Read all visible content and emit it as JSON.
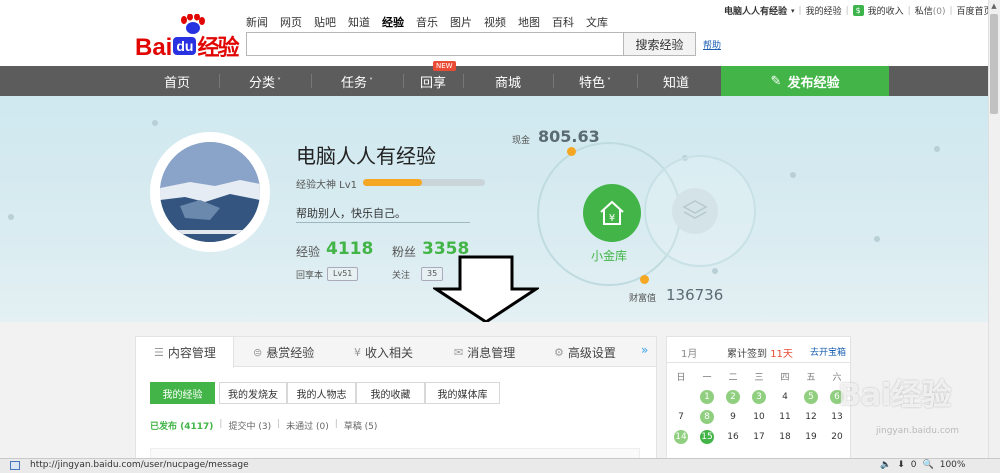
{
  "header": {
    "logo_bai": "Bai",
    "logo_du": "du",
    "logo_jingyan": "经验",
    "topnav": [
      "新闻",
      "网页",
      "贴吧",
      "知道",
      "经验",
      "音乐",
      "图片",
      "视频",
      "地图",
      "百科",
      "文库"
    ],
    "topnav_active": "经验",
    "search_value": "",
    "search_button": "搜索经验",
    "help": "帮助",
    "user": {
      "name": "电脑人人有经验",
      "my_exp": "我的经验",
      "my_income": "我的收入",
      "messages": "私信",
      "message_count": "(0)",
      "home": "百度首页"
    }
  },
  "mainnav": {
    "items": [
      "首页",
      "分类",
      "任务",
      "回享",
      "商城",
      "特色",
      "知道"
    ],
    "new_badge": "NEW",
    "publish": "发布经验"
  },
  "profile": {
    "name": "电脑人人有经验",
    "level": "经验大神 Lv1",
    "level_progress": 0.48,
    "motto": "帮助别人，快乐自己。",
    "exp_label": "经验",
    "exp_value": "4118",
    "fans_label": "粉丝",
    "fans_value": "3358",
    "huixiang_label": "回享本",
    "huixiang_value": "Lv51",
    "follow_label": "关注",
    "follow_value": "35",
    "cash_label": "现金",
    "cash_value": "805.63",
    "wealth_label": "财富值",
    "wealth_value": "136736",
    "vault_label": "小金库"
  },
  "tabs": {
    "items": [
      "内容管理",
      "悬赏经验",
      "收入相关",
      "消息管理",
      "高级设置"
    ],
    "more": "»",
    "subtabs": [
      "我的经验",
      "我的发烧友",
      "我的人物志",
      "我的收藏",
      "我的媒体库"
    ],
    "filters": {
      "published": "已发布 (4117)",
      "submitting": "提交中 (3)",
      "rejected": "未通过 (0)",
      "drafts": "草稿 (5)"
    }
  },
  "calendar": {
    "month": "1月",
    "sign_text": "累计签到",
    "sign_days": "11天",
    "open": "去开宝箱",
    "weekdays": [
      "日",
      "一",
      "二",
      "三",
      "四",
      "五",
      "六"
    ],
    "rows": [
      [
        "",
        "1",
        "2",
        "3",
        "4",
        "5",
        "6"
      ],
      [
        "7",
        "8",
        "9",
        "10",
        "11",
        "12",
        "13"
      ],
      [
        "14",
        "15",
        "16",
        "17",
        "18",
        "19",
        "20"
      ]
    ]
  },
  "watermark": {
    "text": "Bai经验",
    "sub": "jingyan.baidu.com"
  },
  "statusbar": {
    "url": "http://jingyan.baidu.com/user/nucpage/message",
    "count": "0",
    "zoom": "100%"
  }
}
